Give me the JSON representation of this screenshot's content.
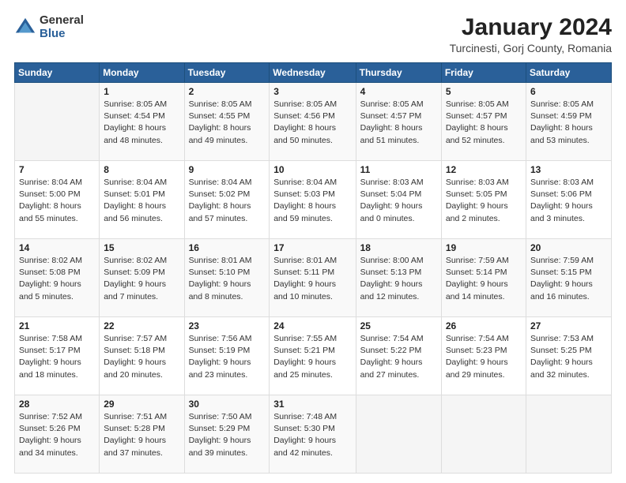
{
  "logo": {
    "general": "General",
    "blue": "Blue"
  },
  "title": {
    "main": "January 2024",
    "sub": "Turcinesti, Gorj County, Romania"
  },
  "weekdays": [
    "Sunday",
    "Monday",
    "Tuesday",
    "Wednesday",
    "Thursday",
    "Friday",
    "Saturday"
  ],
  "weeks": [
    [
      {
        "day": "",
        "info": ""
      },
      {
        "day": "1",
        "info": "Sunrise: 8:05 AM\nSunset: 4:54 PM\nDaylight: 8 hours\nand 48 minutes."
      },
      {
        "day": "2",
        "info": "Sunrise: 8:05 AM\nSunset: 4:55 PM\nDaylight: 8 hours\nand 49 minutes."
      },
      {
        "day": "3",
        "info": "Sunrise: 8:05 AM\nSunset: 4:56 PM\nDaylight: 8 hours\nand 50 minutes."
      },
      {
        "day": "4",
        "info": "Sunrise: 8:05 AM\nSunset: 4:57 PM\nDaylight: 8 hours\nand 51 minutes."
      },
      {
        "day": "5",
        "info": "Sunrise: 8:05 AM\nSunset: 4:57 PM\nDaylight: 8 hours\nand 52 minutes."
      },
      {
        "day": "6",
        "info": "Sunrise: 8:05 AM\nSunset: 4:59 PM\nDaylight: 8 hours\nand 53 minutes."
      }
    ],
    [
      {
        "day": "7",
        "info": "Sunrise: 8:04 AM\nSunset: 5:00 PM\nDaylight: 8 hours\nand 55 minutes."
      },
      {
        "day": "8",
        "info": "Sunrise: 8:04 AM\nSunset: 5:01 PM\nDaylight: 8 hours\nand 56 minutes."
      },
      {
        "day": "9",
        "info": "Sunrise: 8:04 AM\nSunset: 5:02 PM\nDaylight: 8 hours\nand 57 minutes."
      },
      {
        "day": "10",
        "info": "Sunrise: 8:04 AM\nSunset: 5:03 PM\nDaylight: 8 hours\nand 59 minutes."
      },
      {
        "day": "11",
        "info": "Sunrise: 8:03 AM\nSunset: 5:04 PM\nDaylight: 9 hours\nand 0 minutes."
      },
      {
        "day": "12",
        "info": "Sunrise: 8:03 AM\nSunset: 5:05 PM\nDaylight: 9 hours\nand 2 minutes."
      },
      {
        "day": "13",
        "info": "Sunrise: 8:03 AM\nSunset: 5:06 PM\nDaylight: 9 hours\nand 3 minutes."
      }
    ],
    [
      {
        "day": "14",
        "info": "Sunrise: 8:02 AM\nSunset: 5:08 PM\nDaylight: 9 hours\nand 5 minutes."
      },
      {
        "day": "15",
        "info": "Sunrise: 8:02 AM\nSunset: 5:09 PM\nDaylight: 9 hours\nand 7 minutes."
      },
      {
        "day": "16",
        "info": "Sunrise: 8:01 AM\nSunset: 5:10 PM\nDaylight: 9 hours\nand 8 minutes."
      },
      {
        "day": "17",
        "info": "Sunrise: 8:01 AM\nSunset: 5:11 PM\nDaylight: 9 hours\nand 10 minutes."
      },
      {
        "day": "18",
        "info": "Sunrise: 8:00 AM\nSunset: 5:13 PM\nDaylight: 9 hours\nand 12 minutes."
      },
      {
        "day": "19",
        "info": "Sunrise: 7:59 AM\nSunset: 5:14 PM\nDaylight: 9 hours\nand 14 minutes."
      },
      {
        "day": "20",
        "info": "Sunrise: 7:59 AM\nSunset: 5:15 PM\nDaylight: 9 hours\nand 16 minutes."
      }
    ],
    [
      {
        "day": "21",
        "info": "Sunrise: 7:58 AM\nSunset: 5:17 PM\nDaylight: 9 hours\nand 18 minutes."
      },
      {
        "day": "22",
        "info": "Sunrise: 7:57 AM\nSunset: 5:18 PM\nDaylight: 9 hours\nand 20 minutes."
      },
      {
        "day": "23",
        "info": "Sunrise: 7:56 AM\nSunset: 5:19 PM\nDaylight: 9 hours\nand 23 minutes."
      },
      {
        "day": "24",
        "info": "Sunrise: 7:55 AM\nSunset: 5:21 PM\nDaylight: 9 hours\nand 25 minutes."
      },
      {
        "day": "25",
        "info": "Sunrise: 7:54 AM\nSunset: 5:22 PM\nDaylight: 9 hours\nand 27 minutes."
      },
      {
        "day": "26",
        "info": "Sunrise: 7:54 AM\nSunset: 5:23 PM\nDaylight: 9 hours\nand 29 minutes."
      },
      {
        "day": "27",
        "info": "Sunrise: 7:53 AM\nSunset: 5:25 PM\nDaylight: 9 hours\nand 32 minutes."
      }
    ],
    [
      {
        "day": "28",
        "info": "Sunrise: 7:52 AM\nSunset: 5:26 PM\nDaylight: 9 hours\nand 34 minutes."
      },
      {
        "day": "29",
        "info": "Sunrise: 7:51 AM\nSunset: 5:28 PM\nDaylight: 9 hours\nand 37 minutes."
      },
      {
        "day": "30",
        "info": "Sunrise: 7:50 AM\nSunset: 5:29 PM\nDaylight: 9 hours\nand 39 minutes."
      },
      {
        "day": "31",
        "info": "Sunrise: 7:48 AM\nSunset: 5:30 PM\nDaylight: 9 hours\nand 42 minutes."
      },
      {
        "day": "",
        "info": ""
      },
      {
        "day": "",
        "info": ""
      },
      {
        "day": "",
        "info": ""
      }
    ]
  ]
}
